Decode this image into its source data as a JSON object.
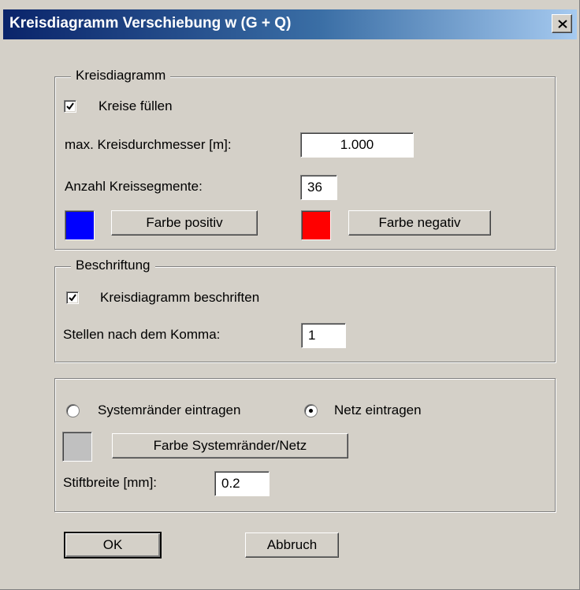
{
  "window": {
    "title": "Kreisdiagramm Verschiebung w (G + Q)"
  },
  "group_diagram": {
    "legend": "Kreisdiagramm",
    "fill_checkbox": {
      "label": "Kreise füllen",
      "checked": true
    },
    "max_diameter": {
      "label": "max. Kreisdurchmesser [m]:",
      "value": "1.000"
    },
    "segments": {
      "label": "Anzahl Kreissegmente:",
      "value": "36"
    },
    "positive": {
      "button": "Farbe positiv",
      "color": "#0000ff"
    },
    "negative": {
      "button": "Farbe negativ",
      "color": "#ff0000"
    }
  },
  "group_label": {
    "legend": "Beschriftung",
    "label_checkbox": {
      "label": "Kreisdiagramm beschriften",
      "checked": true
    },
    "decimals": {
      "label": "Stellen nach dem Komma:",
      "value": "1"
    }
  },
  "group_system": {
    "radio_edges": {
      "label": "Systemränder eintragen",
      "selected": false
    },
    "radio_grid": {
      "label": "Netz eintragen",
      "selected": true
    },
    "color_button": "Farbe Systemränder/Netz",
    "color": "#c0c0c0",
    "pen_width": {
      "label": "Stiftbreite [mm]:",
      "value": "0.2"
    }
  },
  "footer": {
    "ok": "OK",
    "cancel": "Abbruch"
  }
}
